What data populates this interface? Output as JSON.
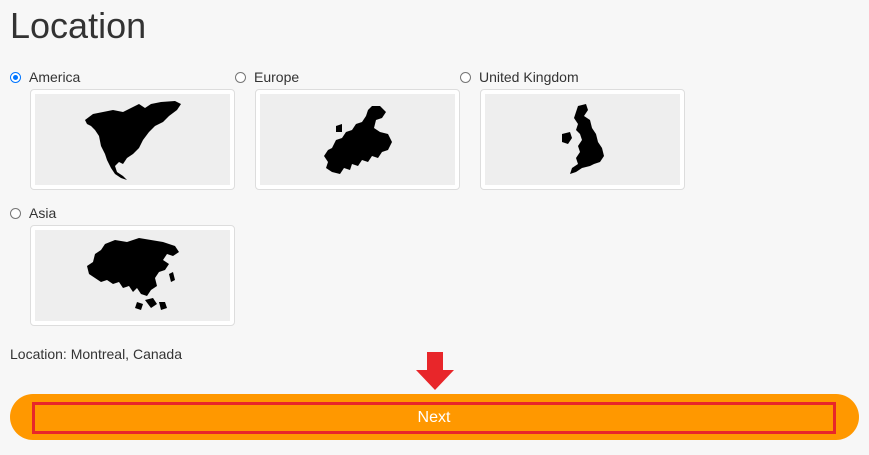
{
  "page": {
    "title": "Location"
  },
  "options": [
    {
      "label": "America",
      "checked": true,
      "map_icon": "north-america-map-icon"
    },
    {
      "label": "Europe",
      "checked": false,
      "map_icon": "europe-map-icon"
    },
    {
      "label": "United Kingdom",
      "checked": false,
      "map_icon": "united-kingdom-map-icon"
    },
    {
      "label": "Asia",
      "checked": false,
      "map_icon": "asia-map-icon"
    }
  ],
  "location": {
    "text": "Location: Montreal, Canada"
  },
  "next": {
    "label": "Next"
  },
  "colors": {
    "accent": "#ff9800",
    "highlight": "#e8262a",
    "radio_checked": "#0075ff",
    "map_background": "#eeeeee"
  }
}
